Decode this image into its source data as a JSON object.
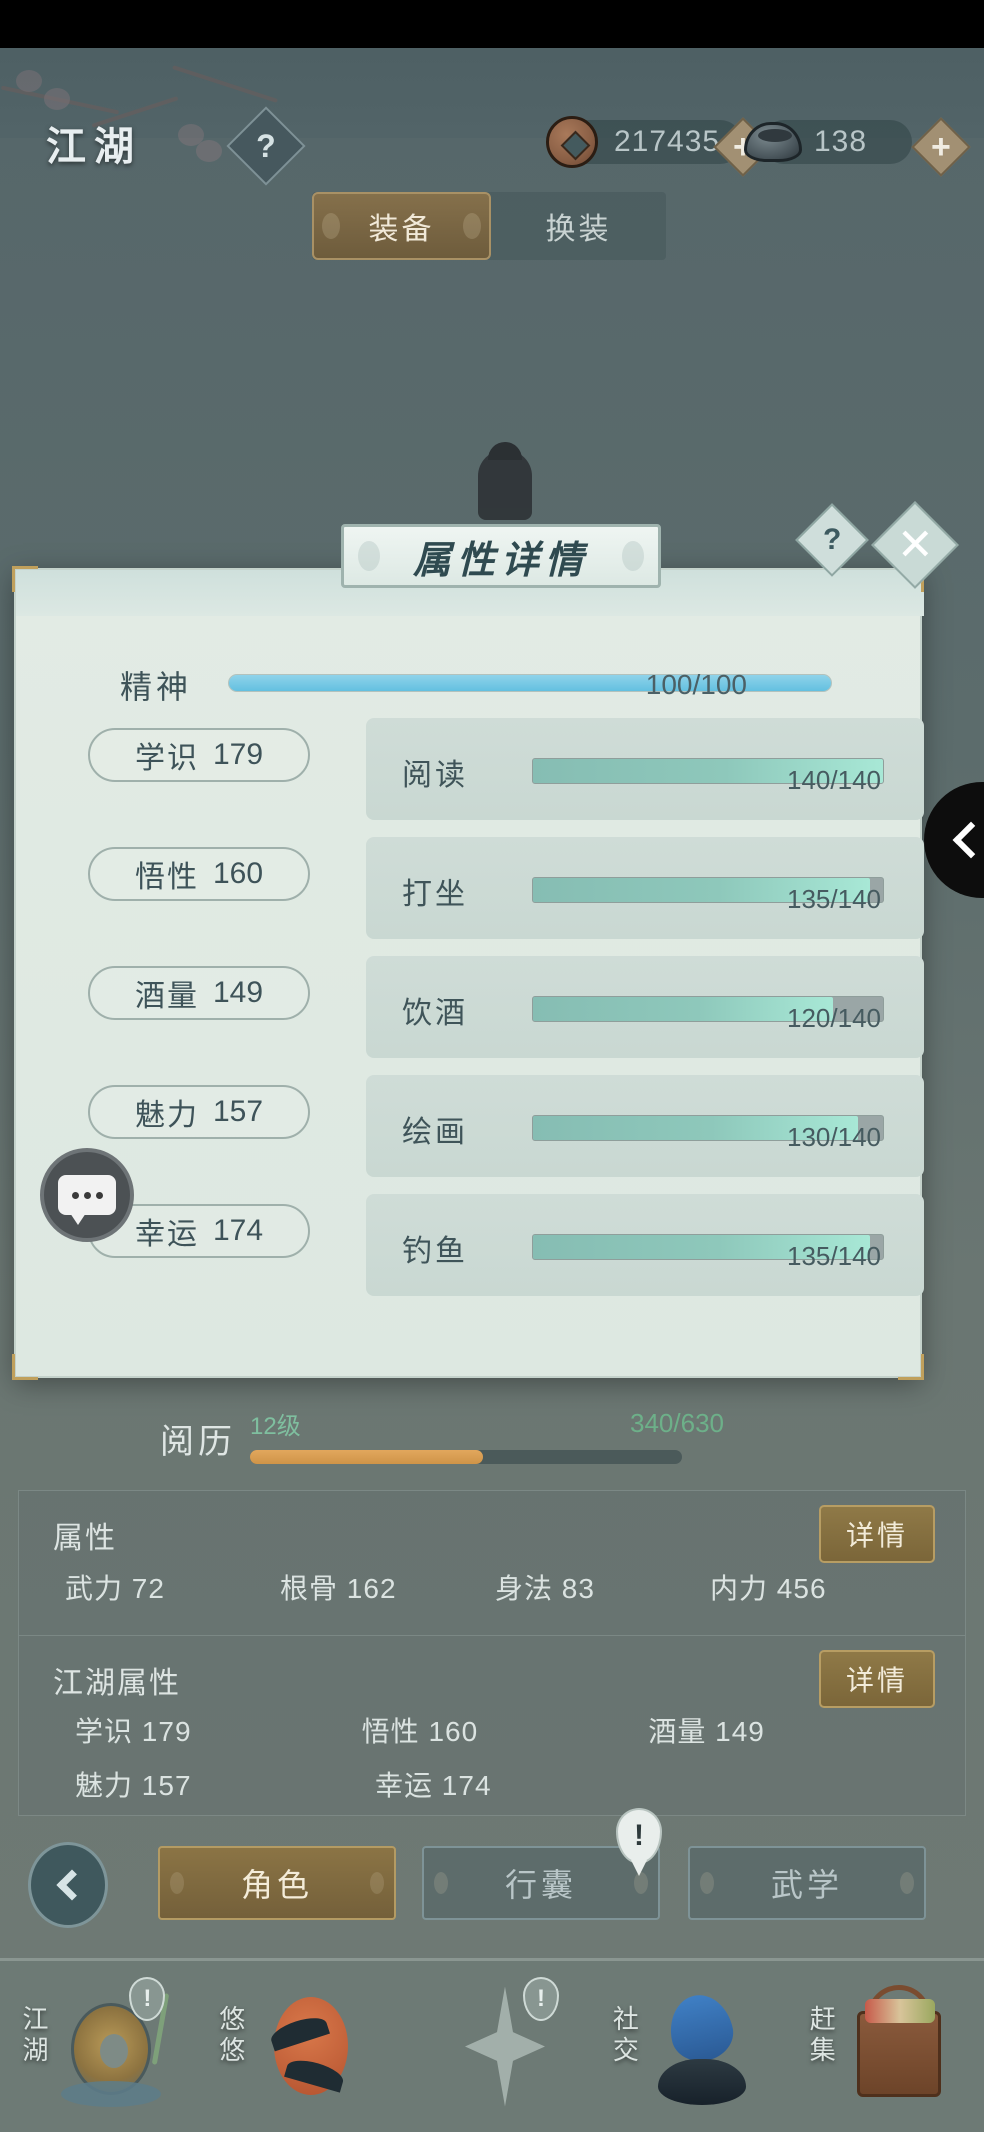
{
  "topbar": {
    "logo": "江湖",
    "help_icon": "?",
    "currencies": [
      {
        "icon": "coin-icon",
        "value": "217435",
        "add": "+"
      },
      {
        "icon": "ingot-icon",
        "value": "138",
        "add": "+"
      }
    ]
  },
  "equip_tabs": [
    {
      "label": "装备",
      "active": true
    },
    {
      "label": "换装",
      "active": false
    }
  ],
  "modal": {
    "title": "属性详情",
    "help_icon": "?",
    "close_icon": "✕",
    "spirit": {
      "label": "精神",
      "value": "100/100",
      "current": 100,
      "max": 100
    },
    "pills": [
      {
        "name": "学识",
        "value": "179"
      },
      {
        "name": "悟性",
        "value": "160"
      },
      {
        "name": "酒量",
        "value": "149"
      },
      {
        "name": "魅力",
        "value": "157"
      },
      {
        "name": "幸运",
        "value": "174"
      }
    ],
    "skills": [
      {
        "name": "阅读",
        "value": "140/140",
        "current": 140,
        "max": 140
      },
      {
        "name": "打坐",
        "value": "135/140",
        "current": 135,
        "max": 140
      },
      {
        "name": "饮酒",
        "value": "120/140",
        "current": 120,
        "max": 140
      },
      {
        "name": "绘画",
        "value": "130/140",
        "current": 130,
        "max": 140
      },
      {
        "name": "钓鱼",
        "value": "135/140",
        "current": 135,
        "max": 140
      }
    ],
    "side_arrow_icon": "‹"
  },
  "chat_float": {
    "icon": "chat-bubble-icon"
  },
  "experience": {
    "label": "阅历",
    "level": "12级",
    "value": "340/630",
    "current": 340,
    "max": 630
  },
  "attributes": {
    "header": "属性",
    "detail_label": "详情",
    "items": [
      {
        "name": "武力",
        "value": "72"
      },
      {
        "name": "根骨",
        "value": "162"
      },
      {
        "name": "身法",
        "value": "83"
      },
      {
        "name": "内力",
        "value": "456"
      }
    ]
  },
  "jianghu_attributes": {
    "header": "江湖属性",
    "detail_label": "详情",
    "rows": [
      [
        {
          "name": "学识",
          "value": "179"
        },
        {
          "name": "悟性",
          "value": "160"
        },
        {
          "name": "酒量",
          "value": "149"
        }
      ],
      [
        {
          "name": "魅力",
          "value": "157"
        },
        {
          "name": "幸运",
          "value": "174"
        }
      ]
    ]
  },
  "actions": {
    "back_icon": "‹",
    "buttons": [
      {
        "label": "角色",
        "active": true,
        "badge": null
      },
      {
        "label": "行囊",
        "active": false,
        "badge": "!"
      },
      {
        "label": "武学",
        "active": false,
        "badge": null
      }
    ]
  },
  "bottom_nav": [
    {
      "label": "江湖",
      "badge": "!"
    },
    {
      "label": "悠悠",
      "badge": null
    },
    {
      "label": "",
      "badge": "!"
    },
    {
      "label": "社交",
      "badge": null
    },
    {
      "label": "赶集",
      "badge": null
    }
  ],
  "colors": {
    "accent_brown": "#8b7445",
    "spirit_blue": "#63c0e0",
    "skill_teal": "#8ec8bb",
    "exp_orange": "#cf9448",
    "panel_bg": "#dfe9e2"
  }
}
